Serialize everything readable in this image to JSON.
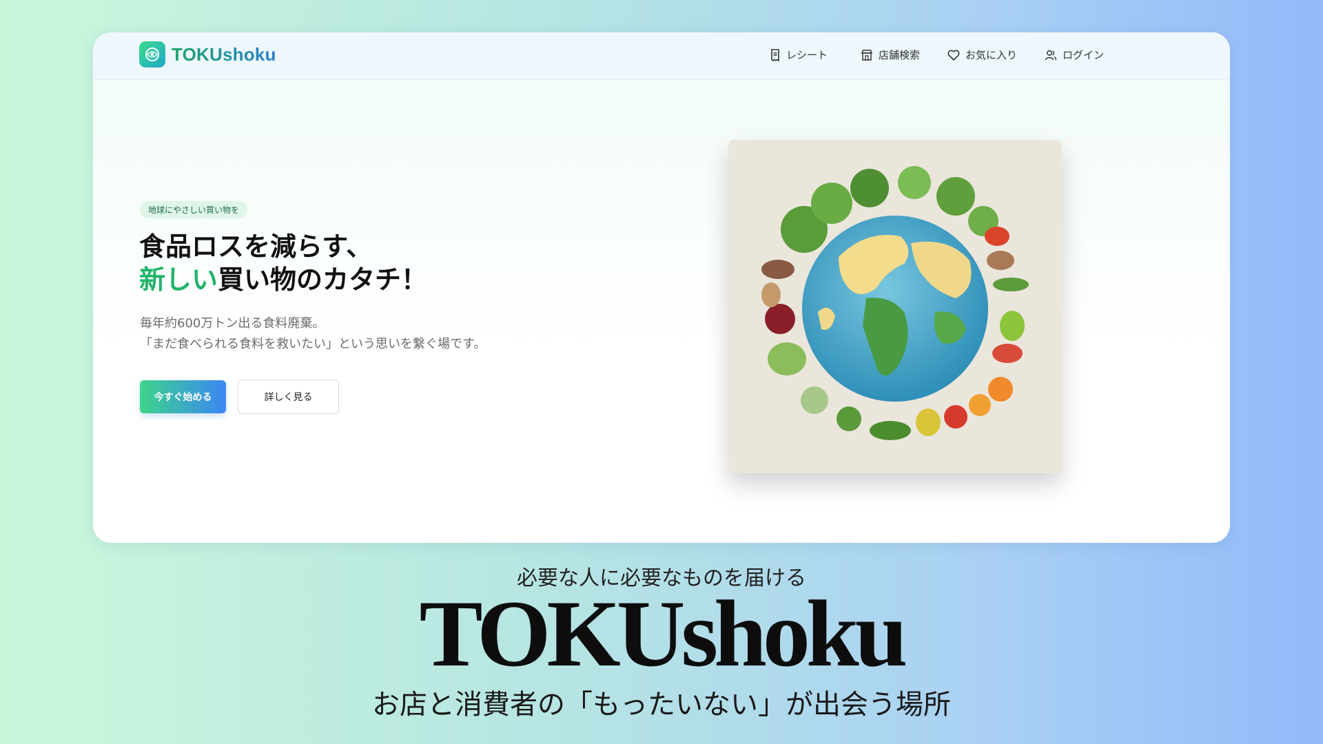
{
  "nav": {
    "brand": "TOKUshoku",
    "items": [
      {
        "label": "レシート",
        "icon": "receipt-icon"
      },
      {
        "label": "店舗検索",
        "icon": "store-icon"
      },
      {
        "label": "お気に入り",
        "icon": "heart-icon"
      },
      {
        "label": "ログイン",
        "icon": "user-icon"
      }
    ]
  },
  "hero": {
    "tag": "地球にやさしい買い物を",
    "headline_line1": "食品ロスを減らす、",
    "headline_accent": "新しい",
    "headline_rest": "買い物のカタチ！",
    "desc_line1": "毎年約600万トン出る食料廃棄。",
    "desc_line2": "「まだ食べられる食料を救いたい」という思いを繋ぐ場です。",
    "primary_button": "今すぐ始める",
    "secondary_button": "詳しく見る"
  },
  "banner": {
    "subtitle": "必要な人に必要なものを届ける",
    "brand": "TOKUshoku",
    "tagline": "お店と消費者の「もったいない」が出会う場所"
  },
  "colors": {
    "accent_green": "#22b36a",
    "accent_blue": "#3b86f3",
    "tag_bg": "#dff5e8"
  }
}
